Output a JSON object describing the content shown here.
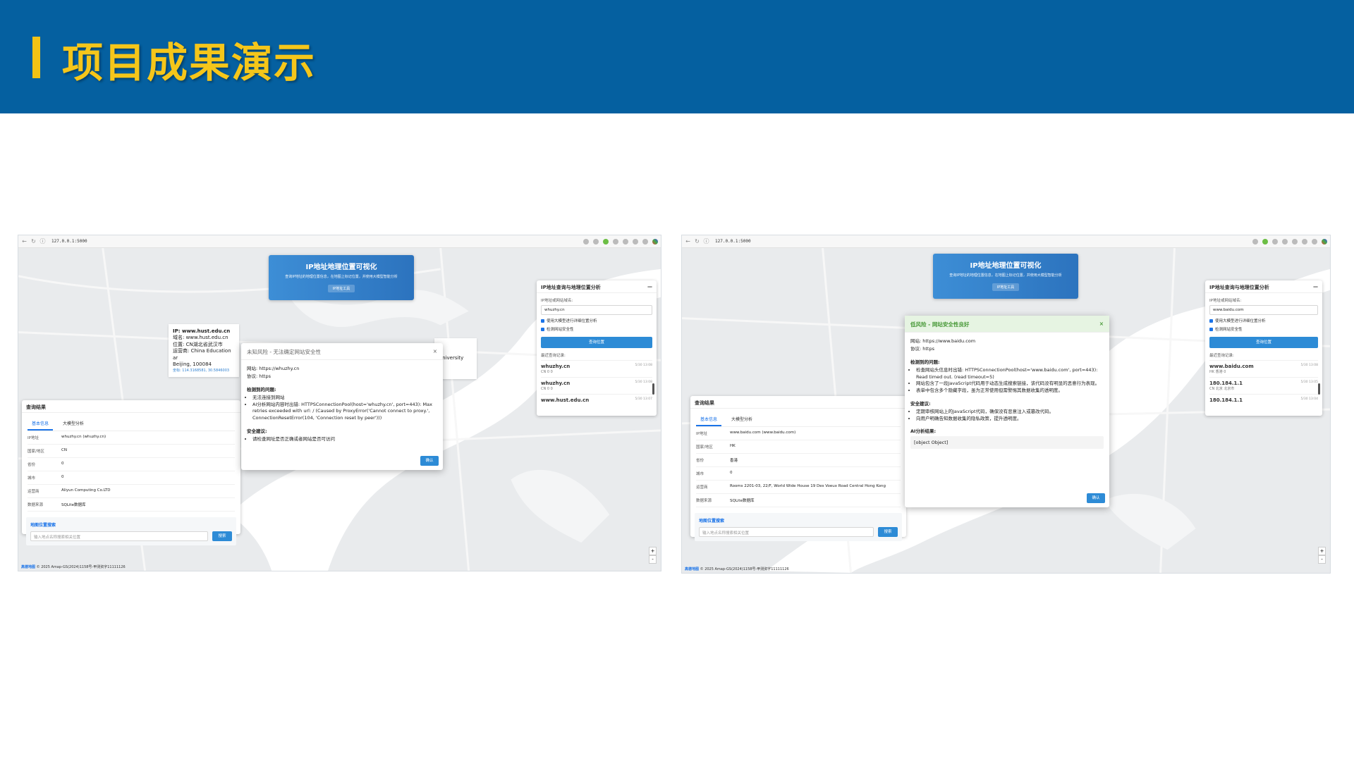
{
  "slide": {
    "title": "项目成果演示"
  },
  "browser": {
    "url": "127.0.0.1:5000"
  },
  "hero": {
    "title": "IP地址地理位置可视化",
    "subtitle": "查询IP地址的地理位置信息，在地图上标记位置，并使用大模型智能分析",
    "button": "IP地址工具"
  },
  "query_panel": {
    "title": "IP地址查询与地理位置分析",
    "collapse": "—",
    "input_label": "IP地址或网站域名:",
    "chk_llm": "使用大模型进行详细位置分析",
    "chk_security": "检测网站安全性",
    "submit": "查询位置",
    "history_label": "最近查询记录:"
  },
  "left": {
    "input_value": "whuzhy.cn",
    "history": [
      {
        "host": "whuzhy.cn",
        "sub": "CN 0 0",
        "time": "5/30 13:08"
      },
      {
        "host": "whuzhy.cn",
        "sub": "CN 0 0",
        "time": "5/30 13:08"
      },
      {
        "host": "www.hust.edu.cn",
        "sub": "",
        "time": "5/30 13:07"
      }
    ],
    "popup": {
      "ip": "IP: www.hust.edu.cn",
      "domain": "域名: www.hust.edu.cn",
      "location": "位置: CN湖北省武汉市",
      "isp": "运营商: China Education ar",
      "city": "Beijing, 100084",
      "coord": "坐标: 114.3168581, 30.5846003",
      "extra": "University"
    },
    "modal": {
      "title": "未知风险 - 无法确定网站安全性",
      "site": "网站: https://whuzhy.cn",
      "protocol": "协议: https",
      "issues_title": "检测到的问题:",
      "issues": [
        "无法连接到网站",
        "AI分析网站内容时出错: HTTPSConnectionPool(host='whuzhy.cn', port=443): Max retries exceeded with url: / (Caused by ProxyError('Cannot connect to proxy.', ConnectionResetError(104, 'Connection reset by peer')))"
      ],
      "advice_title": "安全建议:",
      "advice": [
        "请检查网址是否正确或者网站是否可访问"
      ],
      "ok": "确认"
    },
    "results": {
      "title": "查询结果",
      "tab_basic": "基本信息",
      "tab_llm": "大模型分析",
      "rows": [
        {
          "k": "IP地址",
          "v": "whuzhy.cn (whuzhy.cn)"
        },
        {
          "k": "国家/地区",
          "v": "CN"
        },
        {
          "k": "省份",
          "v": "0"
        },
        {
          "k": "城市",
          "v": "0"
        },
        {
          "k": "运营商",
          "v": "Aliyun Computing Co.LTD"
        },
        {
          "k": "数据来源",
          "v": "SQLite数据库"
        }
      ],
      "search_title": "地图位置搜索",
      "search_placeholder": "输入地点名称搜索相关位置",
      "search_btn": "搜索"
    },
    "footer": "© 2025 Amap-GS(2024)1158号-甲测资字11111126"
  },
  "right": {
    "input_value": "www.baidu.com",
    "history": [
      {
        "host": "www.baidu.com",
        "sub": "HK 香港 0",
        "time": "5/30 13:08"
      },
      {
        "host": "180.184.1.1",
        "sub": "CN 北京 北京市",
        "time": "5/30 13:05"
      },
      {
        "host": "180.184.1.1",
        "sub": "",
        "time": "5/30 13:04"
      }
    ],
    "modal": {
      "title": "低风险 - 网站安全性良好",
      "site": "网站: https://www.baidu.com",
      "protocol": "协议: https",
      "issues_title": "检测到的问题:",
      "issues": [
        "检查网站头信息时出错: HTTPSConnectionPool(host='www.baidu.com', port=443): Read timed out. (read timeout=5)",
        "网站包含了一段JavaScript代码用于动态生成搜索链接，该代码没有明显的恶意行为表现。",
        "表单中包含多个隐藏字段，虽为正常使用但需警惕其数据收集的透明度。"
      ],
      "advice_title": "安全建议:",
      "advice": [
        "定期审核网站上的JavaScript代码，确保没有恶意注入或篡改代码。",
        "向用户明确告知数据收集的隐私政策，提升透明度。"
      ],
      "ai_title": "AI分析结果:",
      "ai_value": "[object Object]",
      "ok": "确认"
    },
    "results": {
      "title": "查询结果",
      "tab_basic": "基本信息",
      "tab_llm": "大模型分析",
      "rows": [
        {
          "k": "IP地址",
          "v": "www.baidu.com (www.baidu.com)"
        },
        {
          "k": "国家/地区",
          "v": "HK"
        },
        {
          "k": "省份",
          "v": "香港"
        },
        {
          "k": "城市",
          "v": "0"
        },
        {
          "k": "运营商",
          "v": "Rooms 2201-03, 22/F, World Wide House 19 Des Voeux Road Central Hong Kong"
        },
        {
          "k": "数据来源",
          "v": "SQLite数据库"
        }
      ],
      "search_title": "地图位置搜索",
      "search_placeholder": "输入地点名称搜索相关位置",
      "search_btn": "搜索"
    },
    "footer": "© 2025 Amap-GS(2024)1158号-甲测资字11111126"
  },
  "map": {
    "brand": "高德地图",
    "zoom_in": "+",
    "zoom_out": "-"
  }
}
